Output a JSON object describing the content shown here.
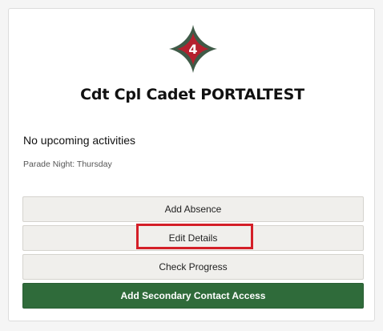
{
  "profile": {
    "badge_number": "4",
    "name": "Cdt Cpl Cadet PORTALTEST"
  },
  "info": {
    "activities_text": "No upcoming activities",
    "parade_night": "Parade Night: Thursday"
  },
  "actions": {
    "add_absence": "Add Absence",
    "edit_details": "Edit Details",
    "check_progress": "Check Progress",
    "add_secondary_contact": "Add Secondary Contact Access"
  },
  "colors": {
    "badge_outer": "#3f5a47",
    "badge_inner": "#b5202e",
    "primary_button": "#2f6b3a",
    "highlight": "#d41f28"
  }
}
